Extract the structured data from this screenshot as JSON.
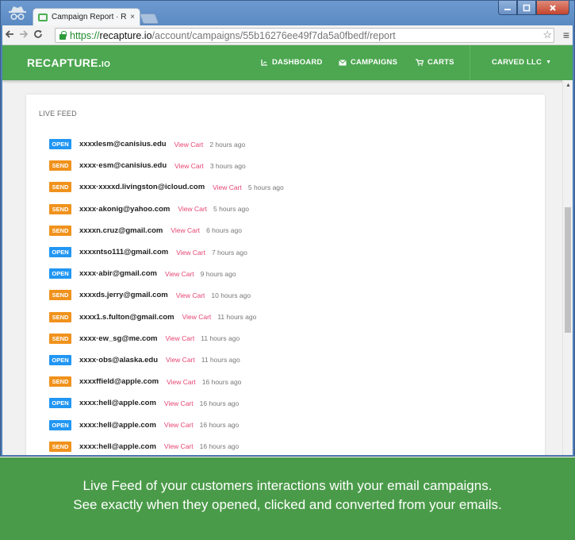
{
  "browser": {
    "tab_title": "Campaign Report · Recapt",
    "tab_close": "×",
    "url_scheme": "https://",
    "url_host": "recapture.io",
    "url_path": "/account/campaigns/55b16276ee49f7da5a0fbedf/report"
  },
  "app": {
    "logo_main": "RECAPTURE.",
    "logo_suffix": "IO",
    "nav": [
      {
        "label": "DASHBOARD",
        "icon": "chart-icon"
      },
      {
        "label": "CAMPAIGNS",
        "icon": "envelope-icon"
      },
      {
        "label": "CARTS",
        "icon": "cart-icon"
      }
    ],
    "account": "CARVED LLC",
    "account_caret": "▼"
  },
  "feed": {
    "title": "LIVE FEED",
    "items": [
      {
        "status": "OPEN",
        "email": "xxxxlesm@canisius.edu",
        "link": "View Cart",
        "ago": "2 hours ago"
      },
      {
        "status": "SEND",
        "email": "xxxx·esm@canisius.edu",
        "link": "View Cart",
        "ago": "3 hours ago"
      },
      {
        "status": "SEND",
        "email": "xxxx·xxxxd.livingston@icloud.com",
        "link": "View Cart",
        "ago": "5 hours ago"
      },
      {
        "status": "SEND",
        "email": "xxxx·akonig@yahoo.com",
        "link": "View Cart",
        "ago": "5 hours ago"
      },
      {
        "status": "SEND",
        "email": "xxxxn.cruz@gmail.com",
        "link": "View Cart",
        "ago": "6 hours ago"
      },
      {
        "status": "OPEN",
        "email": "xxxxntso111@gmail.com",
        "link": "View Cart",
        "ago": "7 hours ago"
      },
      {
        "status": "OPEN",
        "email": "xxxx·abir@gmail.com",
        "link": "View Cart",
        "ago": "9 hours ago"
      },
      {
        "status": "SEND",
        "email": "xxxxds.jerry@gmail.com",
        "link": "View Cart",
        "ago": "10 hours ago"
      },
      {
        "status": "SEND",
        "email": "xxxx1.s.fulton@gmail.com",
        "link": "View Cart",
        "ago": "11 hours ago"
      },
      {
        "status": "SEND",
        "email": "xxxx·ew_sg@me.com",
        "link": "View Cart",
        "ago": "11 hours ago"
      },
      {
        "status": "OPEN",
        "email": "xxxx·obs@alaska.edu",
        "link": "View Cart",
        "ago": "11 hours ago"
      },
      {
        "status": "SEND",
        "email": "xxxxffield@apple.com",
        "link": "View Cart",
        "ago": "16 hours ago"
      },
      {
        "status": "OPEN",
        "email": "xxxx:hell@apple.com",
        "link": "View Cart",
        "ago": "16 hours ago"
      },
      {
        "status": "OPEN",
        "email": "xxxx:hell@apple.com",
        "link": "View Cart",
        "ago": "16 hours ago"
      },
      {
        "status": "SEND",
        "email": "xxxx:hell@apple.com",
        "link": "View Cart",
        "ago": "16 hours ago"
      }
    ]
  },
  "caption": {
    "line1": "Live Feed of your customers interactions with your email campaigns.",
    "line2": "See exactly when they opened, clicked and converted from your emails."
  }
}
